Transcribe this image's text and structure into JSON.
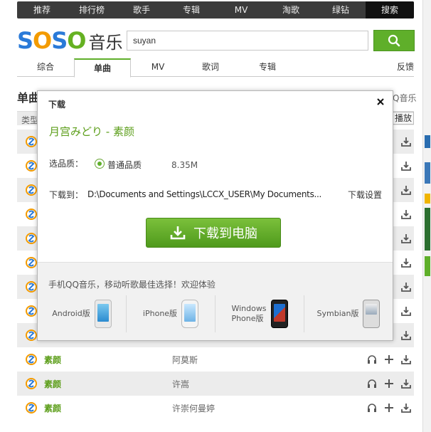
{
  "topnav": {
    "items": [
      "推荐",
      "排行榜",
      "歌手",
      "专辑",
      "MV",
      "淘歌",
      "绿钻"
    ],
    "search": "搜索"
  },
  "logo": {
    "s1": "S",
    "o1": "O",
    "s2": "S",
    "o2": "O",
    "music": "音乐"
  },
  "search": {
    "value": "suyan"
  },
  "tabs": [
    "综合",
    "单曲",
    "MV",
    "歌词",
    "专辑"
  ],
  "feedback": "反馈",
  "underlying": {
    "section_title": "单曲",
    "qq_fragment": "Q音乐",
    "type_fragment": "类型",
    "play_fragment": "播放"
  },
  "rows": [
    {
      "song": "",
      "artist": ""
    },
    {
      "song": "",
      "artist": ""
    },
    {
      "song": "",
      "artist": ""
    },
    {
      "song": "",
      "artist": ""
    },
    {
      "song": "",
      "artist": ""
    },
    {
      "song": "",
      "artist": ""
    },
    {
      "song": "",
      "artist": ""
    },
    {
      "song": "",
      "artist": ""
    },
    {
      "song": "",
      "artist": ""
    },
    {
      "song": "素颜",
      "artist": "阿莫斯"
    },
    {
      "song": "素颜",
      "artist": "许嵩"
    },
    {
      "song": "素颜",
      "artist": "许崇何曼婷"
    }
  ],
  "modal": {
    "title": "下载",
    "song_title": "月宫みどり - 素颜",
    "quality_label": "选品质：",
    "quality_option": "普通品质",
    "quality_size": "8.35M",
    "path_label": "下载到：",
    "path_value": "D:\\Documents and Settings\\LCCX_USER\\My Documents...",
    "path_settings": "下载设置",
    "download_button": "下载到电脑",
    "promo_text": "手机QQ音乐，移动听歌最佳选择！欢迎体验",
    "platforms": [
      {
        "name_line1": "Android版",
        "name_line2": ""
      },
      {
        "name_line1": "iPhone版",
        "name_line2": ""
      },
      {
        "name_line1": "Windows",
        "name_line2": "Phone版"
      },
      {
        "name_line1": "Symbian版",
        "name_line2": ""
      }
    ]
  },
  "colors": {
    "accent_green": "#5faf2a",
    "song_green": "#5c9e1a",
    "nav_dark": "#3b3b3b"
  }
}
